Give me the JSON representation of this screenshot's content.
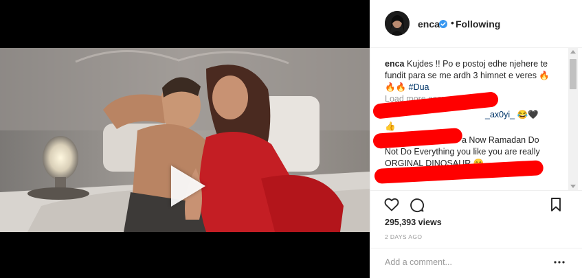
{
  "post": {
    "username": "enca",
    "follow_status": "Following",
    "separator": "•"
  },
  "caption": {
    "username": "enca",
    "text": "Kujdes !! Po e postoj edhe njehere te fundit para se me ardh 3 himnet e veres 🔥",
    "emoji_line": "🔥🔥",
    "hashtag": "#Dua"
  },
  "comments": {
    "load_more": "Load more comments",
    "items": [
      {
        "mention": "_ax0yi_",
        "text": "😂🖤",
        "tail": "👍"
      },
      {
        "text_line1": "a Now Ramadan Do",
        "text_line2": "Not Do Everything you like you are really",
        "text_line3": "ORGINAL DINOSAUR 😋"
      }
    ]
  },
  "stats": {
    "views": "295,393 views",
    "timestamp": "2 DAYS AGO"
  },
  "add_comment": {
    "placeholder": "Add a comment..."
  },
  "icons": [
    "play-icon",
    "verified-icon",
    "heart-icon",
    "comment-icon",
    "bookmark-icon",
    "more-options-icon"
  ],
  "colors": {
    "text": "#262626",
    "muted": "#999999",
    "link": "#003569",
    "verified": "#3897f0",
    "redaction": "#ff0000",
    "divider": "#efefef"
  }
}
